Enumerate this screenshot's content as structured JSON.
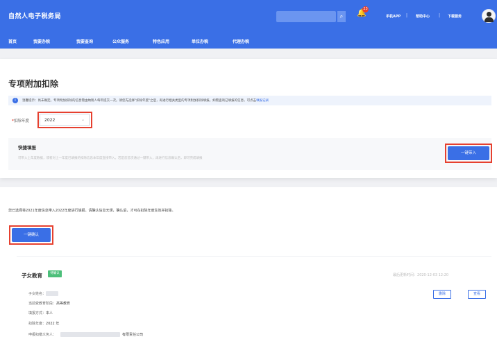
{
  "header": {
    "brand": "自然人电子税务局",
    "notification_count": "23",
    "links": [
      "手机APP",
      "帮助中心",
      "下载服务"
    ]
  },
  "nav": {
    "items": [
      "首页",
      "我要办税",
      "我要查询",
      "公众服务",
      "特色应用",
      "单位办税",
      "代理办税"
    ]
  },
  "page": {
    "title": "专项附加扣除",
    "notice_text": "温馨提示：尚未确定。专项附加扣除的信息需由纳税人每年提交一次。请您先选择\"扣除年度\"之后，再进行相关类型的专项附加扣除填报。如需查询已填报的信息，可点击",
    "notice_link": "填报记录",
    "year_label": "扣除年度",
    "year_required": "*",
    "year_value": "2022",
    "quick_title": "快捷填报",
    "quick_desc": "可带入上年度数据，或者对上一年度已填报的扣除信息本年度直接带入。若是您首次通过一键带入，再进行信息确认后，即可完成填报",
    "quick_button": "一键带入"
  },
  "confirm": {
    "intro": "您已选择将2021年度信息带入2022年度进行填报。请确认信息无误，确认后，才可在扣除年度生效并扣除。",
    "button": "一键确认"
  },
  "record": {
    "title": "子女教育",
    "badge": "待确认",
    "time_label": "最后更新时间：",
    "time_value": "2020-12-03 12:20",
    "fields": [
      {
        "label": "子女姓名：",
        "value": ""
      },
      {
        "label": "当前受教育阶段：",
        "value": "高等教育"
      },
      {
        "label": "填报方式：",
        "value": "本人"
      },
      {
        "label": "扣除年度：",
        "value": "2022 年"
      },
      {
        "label": "申报扣缴义务人：",
        "value": "有限责任公司"
      }
    ],
    "actions": [
      "删除",
      "查看"
    ]
  },
  "colors": {
    "brand_blue": "#3a6fe6",
    "highlight_red": "#e6402f",
    "status_green": "#4cbf7a"
  },
  "icons": [
    "search-icon",
    "bell-icon",
    "info-icon",
    "chevron-down-icon",
    "avatar"
  ]
}
